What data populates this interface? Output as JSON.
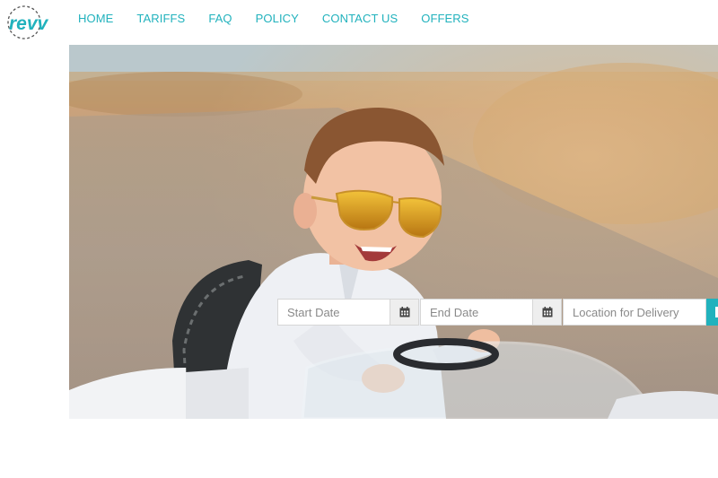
{
  "brand": {
    "name": "revv",
    "color": "#21b2bd"
  },
  "nav": {
    "items": [
      {
        "label": "HOME"
      },
      {
        "label": "TARIFFS"
      },
      {
        "label": "FAQ"
      },
      {
        "label": "POLICY"
      },
      {
        "label": "CONTACT US"
      },
      {
        "label": "OFFERS"
      }
    ]
  },
  "hero": {
    "image": "child-with-orange-sunglasses-in-toy-car"
  },
  "search": {
    "start_date_placeholder": "Start Date",
    "end_date_placeholder": "End Date",
    "location_placeholder": "Location for Delivery",
    "calendar_icon": "calendar-icon",
    "button_color": "#21b2bd"
  }
}
